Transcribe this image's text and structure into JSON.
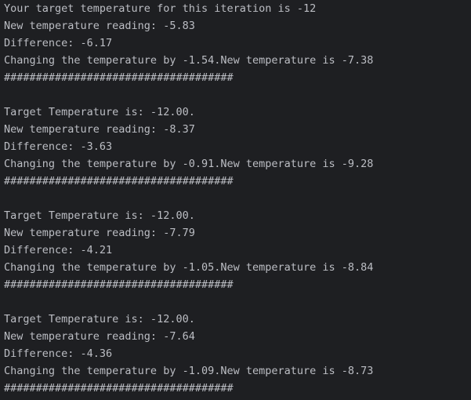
{
  "console": {
    "lines": [
      "Your target temperature for this iteration is -12",
      "New temperature reading: -5.83",
      "Difference: -6.17",
      "Changing the temperature by -1.54.New temperature is -7.38",
      "####################################",
      "",
      "Target Temperature is: -12.00.",
      "New temperature reading: -8.37",
      "Difference: -3.63",
      "Changing the temperature by -0.91.New temperature is -9.28",
      "####################################",
      "",
      "Target Temperature is: -12.00.",
      "New temperature reading: -7.79",
      "Difference: -4.21",
      "Changing the temperature by -1.05.New temperature is -8.84",
      "####################################",
      "",
      "Target Temperature is: -12.00.",
      "New temperature reading: -7.64",
      "Difference: -4.36",
      "Changing the temperature by -1.09.New temperature is -8.73",
      "####################################"
    ]
  },
  "colors": {
    "background": "#1e1f22",
    "text": "#bcbec4"
  }
}
